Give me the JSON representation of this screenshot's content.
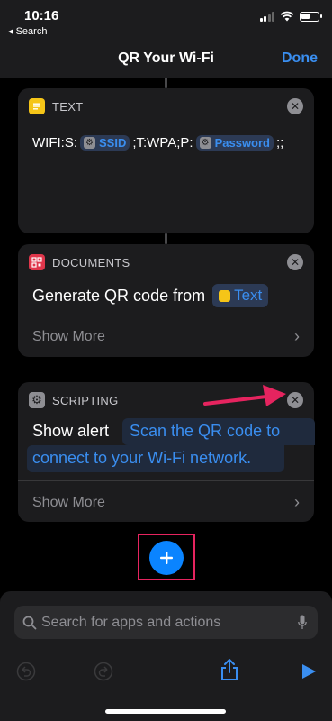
{
  "status_bar": {
    "time": "10:16",
    "back_label": "◂ Search"
  },
  "nav": {
    "title": "QR Your Wi-Fi",
    "done_label": "Done"
  },
  "actions": {
    "text": {
      "category": "TEXT",
      "content_prefix": "WIFI:S:",
      "ssid_token": "SSID",
      "content_middle": ";T:WPA;P:",
      "password_token": "Password",
      "content_suffix": ";;"
    },
    "documents": {
      "category": "DOCUMENTS",
      "verb": "Generate QR code from",
      "input_token": "Text",
      "show_more": "Show More"
    },
    "scripting": {
      "category": "SCRIPTING",
      "verb": "Show alert",
      "message_line1": "Scan the QR code to",
      "message_line2": "connect to your Wi-Fi network.",
      "show_more": "Show More"
    }
  },
  "search": {
    "placeholder": "Search for apps and actions"
  },
  "colors": {
    "accent": "#3a8ef0",
    "highlight": "#e6245f",
    "text_icon": "#f5c518",
    "documents_icon": "#e0364b",
    "scripting_icon": "#8e8e93"
  }
}
